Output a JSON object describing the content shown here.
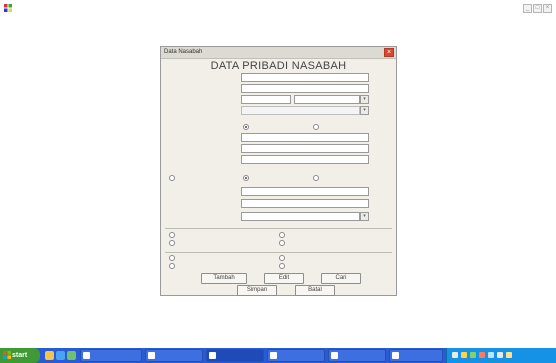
{
  "app": {
    "title": "",
    "menu": [
      "",
      "",
      ""
    ]
  },
  "dialog": {
    "title": "Data Nasabah",
    "close": "×",
    "heading": "DATA PRIBADI NASABAH",
    "fields": [
      {
        "label": "",
        "value": ""
      },
      {
        "label": "",
        "value": ""
      },
      {
        "label": "",
        "value": "",
        "value2": ""
      },
      {
        "label": "",
        "value": ""
      },
      {
        "label": "",
        "value": ""
      },
      {
        "label": "",
        "value": ""
      },
      {
        "label": "",
        "value": ""
      },
      {
        "label": "",
        "value": ""
      },
      {
        "label": "",
        "value": ""
      },
      {
        "label": "",
        "value": ""
      }
    ],
    "gender": {
      "label": "",
      "options": [
        "",
        ""
      ],
      "selected": 0
    },
    "status": {
      "label": "",
      "options": [
        "",
        "",
        ""
      ],
      "selected": 1
    },
    "group1": {
      "label": "",
      "options": [
        "",
        "",
        "",
        ""
      ]
    },
    "group2": {
      "label": "",
      "options": [
        "",
        "",
        "",
        ""
      ]
    },
    "buttons": {
      "tambah": "Tambah",
      "edit": "Edit",
      "cari": "Cari",
      "simpan": "Simpan",
      "batal": "Batal"
    }
  },
  "taskbar": {
    "start": "start",
    "tasks": [
      "",
      "",
      "",
      "",
      "",
      ""
    ],
    "clock": ""
  },
  "colors": {
    "taskbar": "#2a5bd3",
    "start": "#3e9a35",
    "tray": "#1592e6",
    "close": "#d8472e"
  }
}
